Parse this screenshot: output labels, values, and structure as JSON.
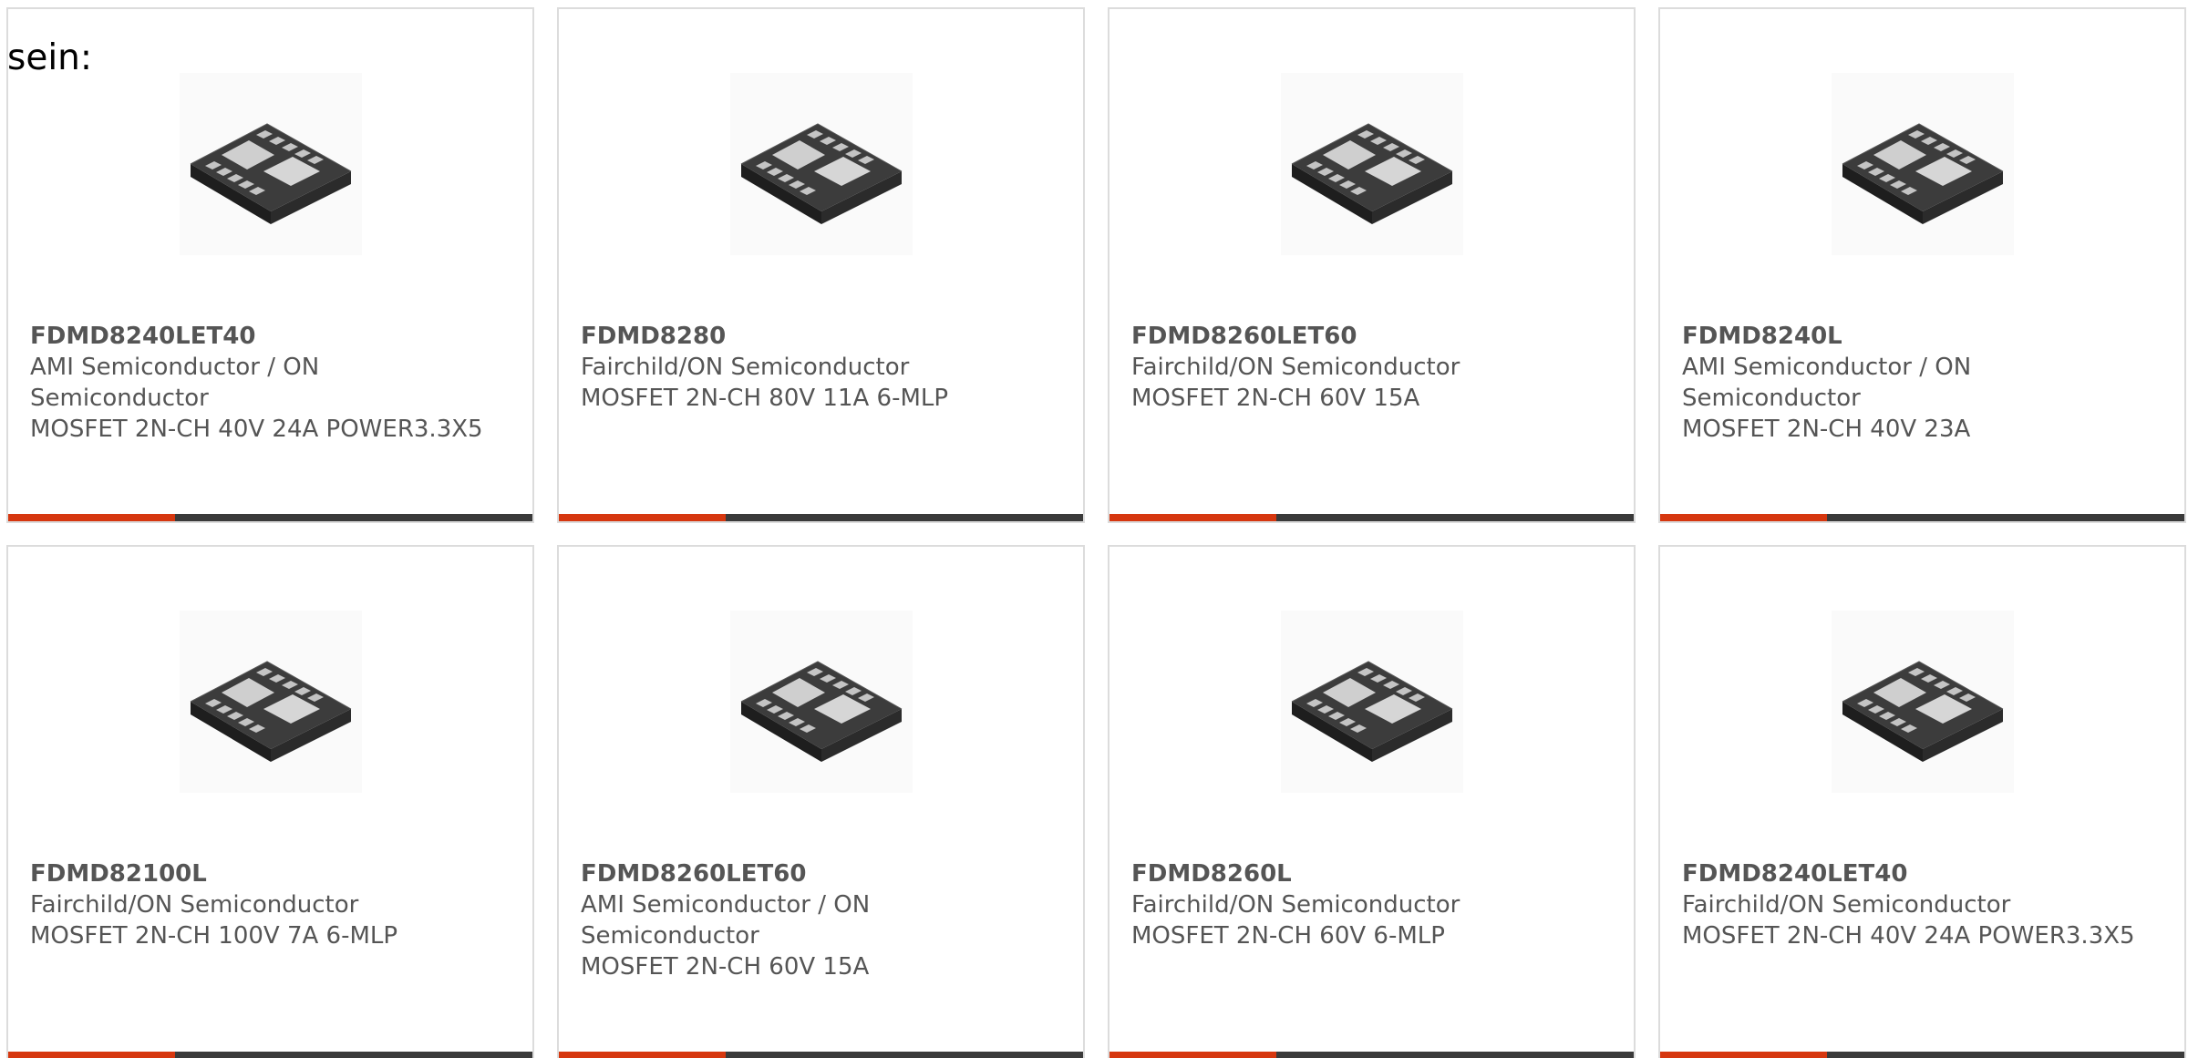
{
  "intro_text": "sein:",
  "colors": {
    "accent": "#d6370f",
    "bar_dark": "#3a3a3a",
    "text": "#555555",
    "border": "#dcdcdc"
  },
  "products": [
    {
      "part": "FDMD8240LET40",
      "manufacturer": "AMI Semiconductor / ON Semiconductor",
      "description": "MOSFET 2N-CH 40V 24A POWER3.3X5",
      "image_icon": "mlp-chip-package-icon"
    },
    {
      "part": "FDMD8280",
      "manufacturer": "Fairchild/ON Semiconductor",
      "description": "MOSFET 2N-CH 80V 11A 6-MLP",
      "image_icon": "mlp-chip-package-icon"
    },
    {
      "part": "FDMD8260LET60",
      "manufacturer": "Fairchild/ON Semiconductor",
      "description": "MOSFET 2N-CH 60V 15A",
      "image_icon": "mlp-chip-package-icon"
    },
    {
      "part": "FDMD8240L",
      "manufacturer": "AMI Semiconductor / ON Semiconductor",
      "description": "MOSFET 2N-CH 40V 23A",
      "image_icon": "mlp-chip-package-icon"
    },
    {
      "part": "FDMD82100L",
      "manufacturer": "Fairchild/ON Semiconductor",
      "description": "MOSFET 2N-CH 100V 7A 6-MLP",
      "image_icon": "mlp-chip-package-icon"
    },
    {
      "part": "FDMD8260LET60",
      "manufacturer": "AMI Semiconductor / ON Semiconductor",
      "description": "MOSFET 2N-CH 60V 15A",
      "image_icon": "mlp-chip-package-icon"
    },
    {
      "part": "FDMD8260L",
      "manufacturer": "Fairchild/ON Semiconductor",
      "description": "MOSFET 2N-CH 60V 6-MLP",
      "image_icon": "mlp-chip-package-icon"
    },
    {
      "part": "FDMD8240LET40",
      "manufacturer": "Fairchild/ON Semiconductor",
      "description": "MOSFET 2N-CH 40V 24A POWER3.3X5",
      "image_icon": "mlp-chip-package-icon"
    }
  ]
}
